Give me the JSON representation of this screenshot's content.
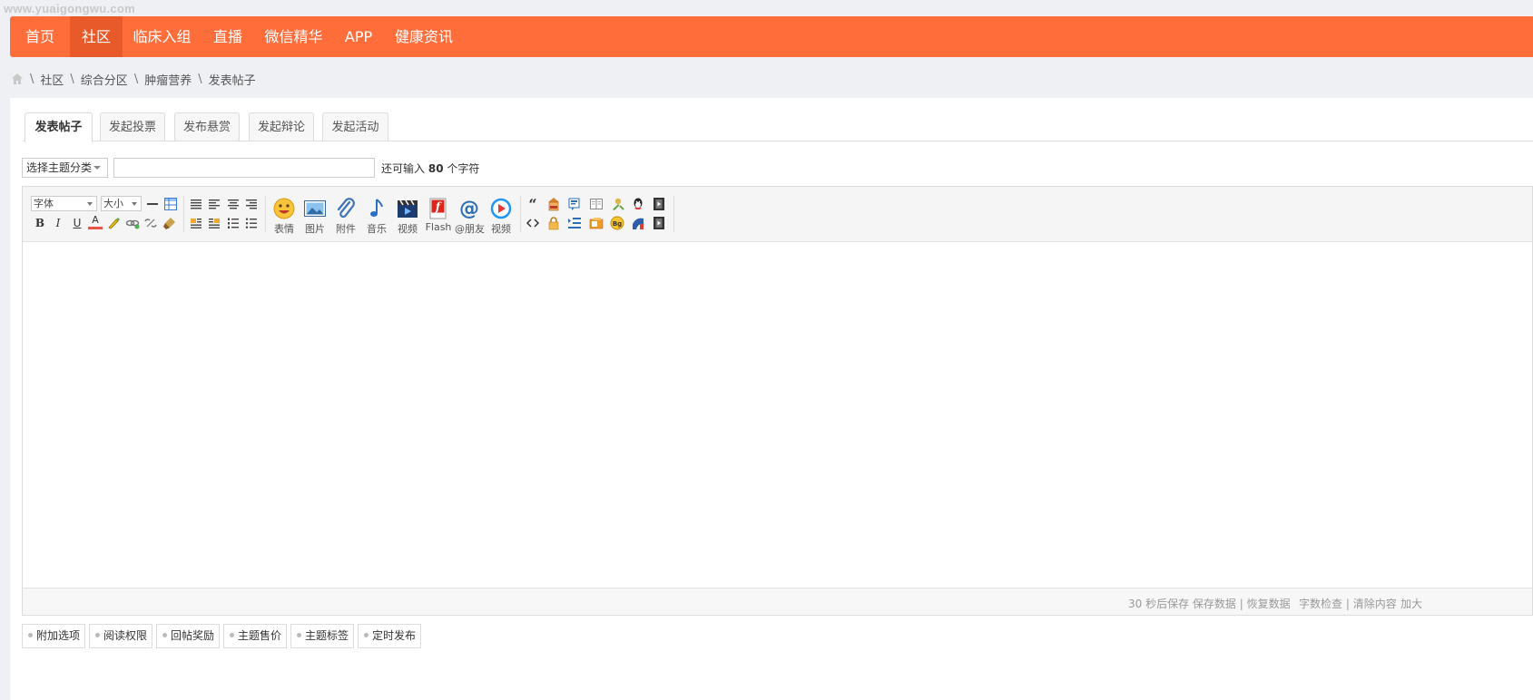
{
  "watermark": "www.yuaigongwu.com",
  "nav": {
    "items": [
      "首页",
      "社区",
      "临床入组",
      "直播",
      "微信精华",
      "APP",
      "健康资讯"
    ],
    "active_index": 1
  },
  "breadcrumb": {
    "home_icon": "home-icon",
    "items": [
      "社区",
      "综合分区",
      "肿瘤营养",
      "发表帖子"
    ],
    "separator": "\\"
  },
  "tabs": [
    "发表帖子",
    "发起投票",
    "发布悬赏",
    "发起辩论",
    "发起活动"
  ],
  "subject": {
    "type_select": "选择主题分类",
    "input_value": "",
    "hint_prefix": "还可输入",
    "hint_count": "80",
    "hint_suffix": "个字符"
  },
  "editor": {
    "font_select": "字体",
    "size_select": "大小",
    "format_buttons": {
      "bold": "B",
      "italic": "I",
      "underline": "U",
      "font_color": "A"
    },
    "big_tools": [
      "表情",
      "图片",
      "附件",
      "音乐",
      "视频",
      "Flash",
      "@朋友",
      "视频"
    ],
    "status": {
      "autosave": "30 秒后保存",
      "save": "保存数据",
      "restore": "恢复数据",
      "divider": "|",
      "word_check": "字数检查",
      "clear": "清除内容",
      "enlarge": "加大"
    }
  },
  "options": [
    "附加选项",
    "阅读权限",
    "回帖奖励",
    "主题售价",
    "主题标签",
    "定时发布"
  ],
  "colors": {
    "nav_bg": "#ff6d3b",
    "nav_active": "#e85a2a",
    "page_bg": "#eef0f4"
  }
}
